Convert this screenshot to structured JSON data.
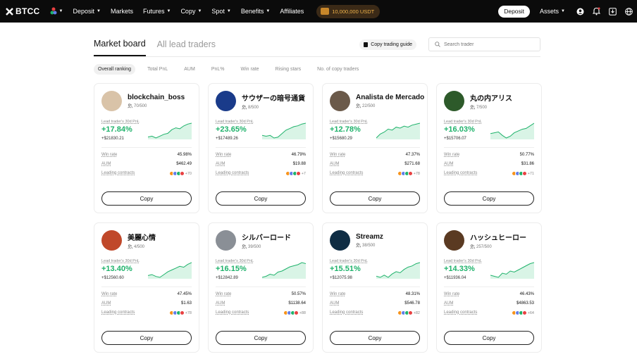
{
  "nav": {
    "brand": "BTCC",
    "items": [
      {
        "label": "Deposit",
        "caret": true
      },
      {
        "label": "Markets",
        "caret": false
      },
      {
        "label": "Futures",
        "caret": true
      },
      {
        "label": "Copy",
        "caret": true
      },
      {
        "label": "Spot",
        "caret": true
      },
      {
        "label": "Benefits",
        "caret": true
      },
      {
        "label": "Affiliates",
        "caret": false
      }
    ],
    "promo": "10,000,000 USDT",
    "deposit_button": "Deposit",
    "assets": "Assets"
  },
  "tabs": [
    "Market board",
    "All lead traders"
  ],
  "guide_label": "Copy trading guide",
  "search_placeholder": "Search trader",
  "filters": [
    "Overall ranking",
    "Total PnL",
    "AUM",
    "PnL%",
    "Win rate",
    "Rising stars",
    "No. of copy traders"
  ],
  "labels": {
    "pnl_label": "Lead trader's 30d PnL",
    "win_rate": "Win rate",
    "aum": "AUM",
    "leading_contracts": "Leading contracts",
    "copy": "Copy"
  },
  "traders": [
    {
      "name": "blockchain_boss",
      "copiers": "70/500",
      "pnl_pct": "+17.84%",
      "pnl_usd": "+$21830.21",
      "win_rate": "45.98%",
      "aum": "$462.49",
      "more": "+70",
      "avatar": "#d9c3a8",
      "spark": [
        5,
        6,
        4,
        6,
        8,
        9,
        13,
        15,
        14,
        17,
        19,
        20
      ]
    },
    {
      "name": "サウザーの暗号通貨",
      "copiers": "8/500",
      "pnl_pct": "+23.65%",
      "pnl_usd": "+$17489.26",
      "win_rate": "46.79%",
      "aum": "$19.88",
      "more": "+7",
      "avatar": "#1a3b8a",
      "spark": [
        6,
        5,
        6,
        3,
        4,
        8,
        12,
        14,
        16,
        17,
        19,
        20
      ]
    },
    {
      "name": "Analista de Mercado",
      "copiers": "22/500",
      "pnl_pct": "+12.78%",
      "pnl_usd": "+$15680.29",
      "win_rate": "47.37%",
      "aum": "$271.68",
      "more": "+78",
      "avatar": "#6b5a4a",
      "spark": [
        4,
        8,
        10,
        13,
        12,
        15,
        14,
        16,
        15,
        17,
        18,
        19
      ]
    },
    {
      "name": "丸の内アリス",
      "copiers": "7/500",
      "pnl_pct": "+16.03%",
      "pnl_usd": "+$15706.07",
      "win_rate": "50.77%",
      "aum": "$31.86",
      "more": "+71",
      "avatar": "#2d5a2a",
      "spark": [
        8,
        9,
        10,
        6,
        3,
        5,
        9,
        11,
        13,
        14,
        17,
        20
      ]
    },
    {
      "name": "美麗心情",
      "copiers": "4/500",
      "pnl_pct": "+13.40%",
      "pnl_usd": "+$12560.60",
      "win_rate": "47.45%",
      "aum": "$1.63",
      "more": "+78",
      "avatar": "#c0482a",
      "spark": [
        5,
        6,
        4,
        3,
        6,
        9,
        11,
        13,
        15,
        14,
        17,
        19
      ]
    },
    {
      "name": "シルバーロード",
      "copiers": "39/500",
      "pnl_pct": "+16.15%",
      "pnl_usd": "+$12842.89",
      "win_rate": "50.57%",
      "aum": "$1138.64",
      "more": "+88",
      "avatar": "#8a8f96",
      "spark": [
        3,
        4,
        6,
        5,
        8,
        9,
        11,
        13,
        14,
        15,
        17,
        16
      ]
    },
    {
      "name": "Streamz",
      "copiers": "38/500",
      "pnl_pct": "+15.51%",
      "pnl_usd": "+$12075.98",
      "win_rate": "48.31%",
      "aum": "$546.78",
      "more": "+82",
      "avatar": "#0f2d44",
      "spark": [
        6,
        5,
        7,
        5,
        8,
        10,
        9,
        12,
        14,
        15,
        17,
        18
      ]
    },
    {
      "name": "ハッシュヒーロー",
      "copiers": "257/500",
      "pnl_pct": "+14.33%",
      "pnl_usd": "+$11936.04",
      "win_rate": "46.43%",
      "aum": "$4863.53",
      "more": "+64",
      "avatar": "#5a3a22",
      "spark": [
        7,
        6,
        5,
        9,
        8,
        11,
        10,
        12,
        14,
        16,
        18,
        19
      ]
    }
  ],
  "coin_colors": [
    "#f7931a",
    "#627eea",
    "#1fb26b",
    "#e84142"
  ]
}
